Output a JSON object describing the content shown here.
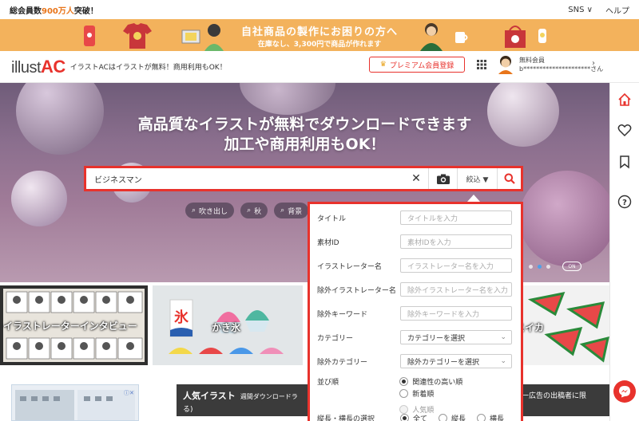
{
  "topbar": {
    "members_prefix": "総会員数",
    "members_count": "900万人",
    "members_suffix": "突破！",
    "sns": "SNS",
    "help": "ヘルプ"
  },
  "promo": {
    "line1": "自社商品の製作にお困りの方へ",
    "line2": "在庫なし、3,300円で商品が作れます"
  },
  "header": {
    "logo_a": "illust",
    "logo_b": "AC",
    "tagline": "イラストACはイラストが無料！商用利用もOK！",
    "premium_label": "プレミアム会員登録",
    "user_status": "無料会員",
    "user_name": "b*********************さん"
  },
  "hero": {
    "line1": "高品質なイラストが無料でダウンロードできます",
    "line2": "加工や商用利用もOK！",
    "toggle": "ON"
  },
  "search": {
    "query": "ビジネスマン",
    "filter_label": "絞込 ▼"
  },
  "chips": [
    "吹き出し",
    "秋",
    "背景"
  ],
  "filter_panel": {
    "title_label": "タイトル",
    "title_placeholder": "タイトルを入力",
    "material_label": "素材ID",
    "material_placeholder": "素材IDを入力",
    "illustrator_label": "イラストレーター名",
    "illustrator_placeholder": "イラストレーター名を入力",
    "exclude_illustrator_label": "除外イラストレーター名",
    "exclude_illustrator_placeholder": "除外イラストレーター名を入力",
    "exclude_keyword_label": "除外キーワード",
    "exclude_keyword_placeholder": "除外キーワードを入力",
    "category_label": "カテゴリー",
    "category_value": "カテゴリーを選択",
    "exclude_category_label": "除外カテゴリー",
    "exclude_category_value": "除外カテゴリーを選択",
    "order_label": "並び順",
    "order_options": [
      "関連性の高い順",
      "新着順",
      "人気順"
    ],
    "orientation_label": "縦長・横長の選択",
    "orientation_options": [
      "全て",
      "縦長",
      "横長"
    ]
  },
  "banners": {
    "interview": "イラストレーターインタビュー",
    "kakigori": "かき氷",
    "kori": "氷",
    "suika": "スイカ"
  },
  "popular": {
    "title": "人気イラスト",
    "subtitle": "週間ダウンロードラ",
    "right_text": "一広告の出稿者に限",
    "second_line": "る)"
  },
  "colors": {
    "accent": "#e8322c",
    "promo": "#f3b25c",
    "hero": "#8b6f8e"
  }
}
